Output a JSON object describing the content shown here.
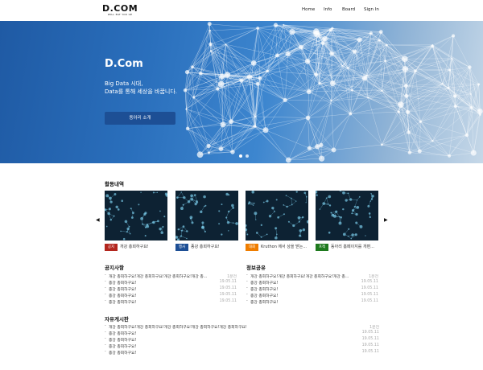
{
  "header": {
    "logo": "D.COM",
    "logo_sub": "WILL EAT YOU UP",
    "nav": [
      "Home",
      "Info",
      "Board",
      "Sign In"
    ]
  },
  "hero": {
    "title": "D.Com",
    "subtitle_line1": "Big Data 시대,",
    "subtitle_line2": "Data를 통해 세상을 바꿉니다.",
    "button": "동아리 소개"
  },
  "activities": {
    "title": "활동내역",
    "cards": [
      {
        "badge": "공지",
        "badge_color": "#b3261e",
        "title": "개강 총회하구요!"
      },
      {
        "badge": "행사",
        "badge_color": "#1d4f95",
        "title": "종강 총회하구요!"
      },
      {
        "badge": "대회",
        "badge_color": "#ef7d00",
        "title": "Kruthon 에서 상을 받는..."
      },
      {
        "badge": "프젝",
        "badge_color": "#1e7a1e",
        "title": "동아리 홈페이지를 개편..."
      }
    ]
  },
  "notice": {
    "title": "공지사항",
    "items": [
      {
        "text": "개강 총회하구요!개강 총회하구요!개강 총회하구요!개강 총...",
        "date": "1분전"
      },
      {
        "text": "종강 총회하구요!",
        "date": "19.05.11"
      },
      {
        "text": "종강 총회하구요!",
        "date": "19.05.11"
      },
      {
        "text": "종강 총회하구요!",
        "date": "19.05.11"
      },
      {
        "text": "종강 총회하구요!",
        "date": "19.05.11"
      }
    ]
  },
  "share": {
    "title": "정보공유",
    "items": [
      {
        "text": "개강 총회하구요!개강 총회하구요!개강 총회하구요!개강 총...",
        "date": "1분전"
      },
      {
        "text": "종강 총회하구요!",
        "date": "19.05.11"
      },
      {
        "text": "종강 총회하구요!",
        "date": "19.05.11"
      },
      {
        "text": "종강 총회하구요!",
        "date": "19.05.11"
      },
      {
        "text": "종강 총회하구요!",
        "date": "19.05.11"
      }
    ]
  },
  "free": {
    "title": "자유게시판",
    "items": [
      {
        "text": "개강 총회하구요!개강 총회하구요!개강 총회하구요!개강 총회하구요!개강 총회하구요!",
        "date": "1분전"
      },
      {
        "text": "종강 총회하구요!",
        "date": "19.05.11"
      },
      {
        "text": "종강 총회하구요!",
        "date": "19.05.11"
      },
      {
        "text": "종강 총회하구요!",
        "date": "19.05.11"
      },
      {
        "text": "종강 총회하구요!",
        "date": "19.05.11"
      }
    ]
  },
  "icons": {
    "prev": "chevron-left-icon",
    "next": "chevron-right-icon",
    "bullet": "dash-bullet-icon"
  }
}
